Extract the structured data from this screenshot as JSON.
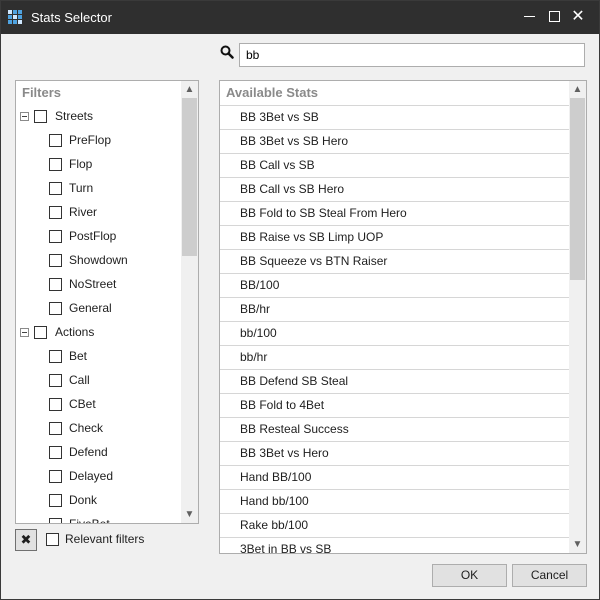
{
  "window": {
    "title": "Stats Selector",
    "app_icon": "app-grid-icon"
  },
  "titlebar_buttons": {
    "minimize": "minimize-icon",
    "maximize": "maximize-icon",
    "close": "close-icon",
    "close_glyph": "✕"
  },
  "search": {
    "icon": "search-icon",
    "value": "bb"
  },
  "filters": {
    "header": "Filters",
    "items": [
      {
        "label": "Streets",
        "level": 0,
        "expanded": true
      },
      {
        "label": "PreFlop",
        "level": 1
      },
      {
        "label": "Flop",
        "level": 1
      },
      {
        "label": "Turn",
        "level": 1
      },
      {
        "label": "River",
        "level": 1
      },
      {
        "label": "PostFlop",
        "level": 1
      },
      {
        "label": "Showdown",
        "level": 1
      },
      {
        "label": "NoStreet",
        "level": 1
      },
      {
        "label": "General",
        "level": 1
      },
      {
        "label": "Actions",
        "level": 0,
        "expanded": true
      },
      {
        "label": "Bet",
        "level": 1
      },
      {
        "label": "Call",
        "level": 1
      },
      {
        "label": "CBet",
        "level": 1
      },
      {
        "label": "Check",
        "level": 1
      },
      {
        "label": "Defend",
        "level": 1
      },
      {
        "label": "Delayed",
        "level": 1
      },
      {
        "label": "Donk",
        "level": 1
      },
      {
        "label": "FiveBet",
        "level": 1
      }
    ],
    "clear_button_glyph": "✖",
    "relevant_filters_label": "Relevant filters"
  },
  "stats": {
    "header": "Available Stats",
    "items": [
      "BB 3Bet vs SB",
      "BB 3Bet vs SB Hero",
      "BB Call vs SB",
      "BB Call vs SB Hero",
      "BB Fold to SB Steal From Hero",
      "BB Raise vs SB Limp UOP",
      "BB Squeeze vs BTN Raiser",
      "BB/100",
      "BB/hr",
      "bb/100",
      "bb/hr",
      "BB Defend SB Steal",
      "BB Fold to 4Bet",
      "BB Resteal Success",
      "BB 3Bet vs Hero",
      "Hand BB/100",
      "Hand bb/100",
      "Rake bb/100",
      "3Bet in BB vs SB"
    ]
  },
  "scroll": {
    "up_glyph": "▲",
    "down_glyph": "▼"
  },
  "buttons": {
    "ok": "OK",
    "cancel": "Cancel"
  }
}
